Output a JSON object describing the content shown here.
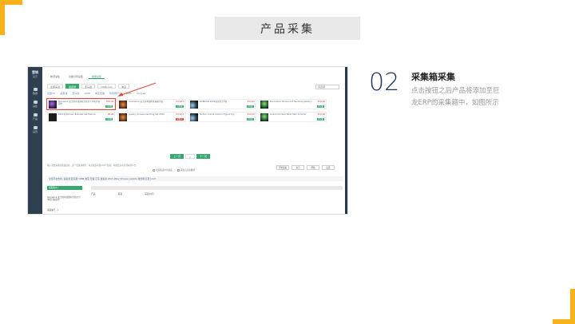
{
  "slide": {
    "title": "产品采集",
    "step_number": "02",
    "step_title": "采集箱采集",
    "step_desc": "点击按钮之后产品将添加至巨龙ERP的采集箱中，如图所示"
  },
  "colors": {
    "accent": "#f5b21b",
    "brand_green": "#35a86b",
    "nav_dark": "#2e3f50",
    "highlight_red": "#e2463f"
  },
  "app": {
    "sidebar": {
      "logo": "营销",
      "sub": "首页",
      "items": [
        "数据",
        "采集",
        "产品",
        "设置"
      ]
    },
    "tabs": [
      "物流采集",
      "功能引导采集",
      "批量采集"
    ],
    "filters": [
      "全部来源",
      "速卖通",
      "亚马逊",
      "1688.com",
      "淘宝"
    ],
    "source_select": "请选择",
    "source_links": [
      "全部(5)",
      "速卖通",
      "亚马逊",
      "1688",
      "淘宝天猫",
      "敦煌网产品",
      "Wish",
      "Shopee"
    ],
    "cards": [
      {
        "title": "Spicewire 女士新年款限时全新大号羊毛针织围巾",
        "price": "¥19.90",
        "btn": "已采集"
      },
      {
        "title": "Cosmetics 女士冬季加厚款保暖手套",
        "price": "US $4.5",
        "btn": "已采集"
      },
      {
        "title": "WARRIOR 2020新款男士T恤",
        "price": "¥34.90",
        "btn": "已采集"
      },
      {
        "title": "Decorative Women Art Necklace Jewelry",
        "price": "¥29.90",
        "btn": "已采集"
      },
      {
        "title": "2021年 Women Bracelet Set Fashion",
        "price": "¥9.90",
        "btn": "已采集"
      },
      {
        "title": "Jewelry Accessories Ring Set 2020",
        "price": "US $2.1",
        "btn": "采集中"
      },
      {
        "title": "Fashion Anime Cartoon Figure Toy",
        "price": "¥12.50",
        "btn": "已采集"
      },
      {
        "title": "Custom Printed Tshirt Men Summer",
        "price": "¥15.00",
        "btn": "已采集"
      }
    ],
    "pager": {
      "prev": "上一页",
      "page": "1",
      "next": "下一页"
    },
    "note": "输入需要采集的商品链接，多个链接请换行。每次最多采集100个链接，系统会自动识别来源平台。",
    "options": [
      "仅采集选中的商品",
      "采集后自动翻译"
    ],
    "actions": [
      "开始采集",
      "清空",
      "帮助",
      "设置"
    ],
    "platform_bar": "全部平台支持: 速卖通 亚马逊 1688 淘宝 天猫 京东 拼多多 Wish eBay Shopee Lazada 敦煌网 虾皮 Joom",
    "lower": {
      "button": "采集箱(5)",
      "columns": [
        "产品",
        "来源",
        "采集时间"
      ],
      "item": "Spicewire 女士新年款限时全新大号羊毛针织围巾",
      "item2": "采集编号 - 1"
    }
  }
}
